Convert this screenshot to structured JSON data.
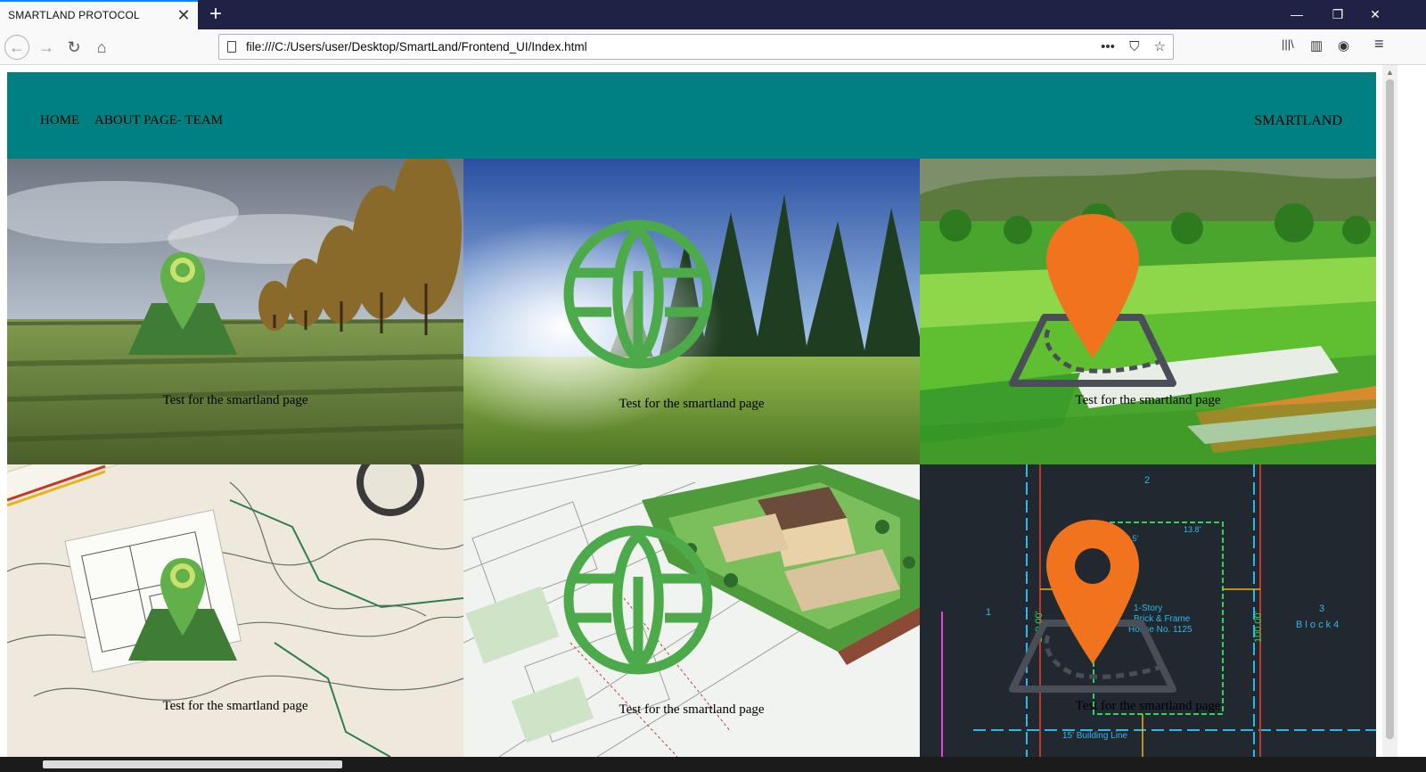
{
  "browser": {
    "tab_title": "SMARTLAND PROTOCOL",
    "tab_close": "✕",
    "new_tab": "+",
    "url": "file:///C:/Users/user/Desktop/SmartLand/Frontend_UI/Index.html",
    "window_controls": {
      "minimize": "—",
      "restore": "❐",
      "close": "✕"
    },
    "nav_icons": {
      "back": "←",
      "forward": "→",
      "reload": "↻",
      "home": "⌂"
    },
    "url_actions": {
      "more": "•••",
      "pocket": "⛉",
      "bookmark": "☆"
    },
    "toolbar_icons": {
      "library": "|||\\",
      "sidebar": "▥",
      "account": "◉",
      "menu": "≡"
    }
  },
  "site": {
    "nav_links": [
      "HOME",
      "ABOUT PAGE- TEAM"
    ],
    "brand": "SMARTLAND",
    "nav_color": "#008080"
  },
  "tiles": [
    {
      "caption": "Test for the smartland page",
      "icon": "map-pin-field-icon",
      "background": "farm-field-with-trees"
    },
    {
      "caption": "Test for the smartland page",
      "icon": "leaf-globe-icon",
      "background": "forest-meadow-sunrise"
    },
    {
      "caption": "Test for the smartland page",
      "icon": "orange-map-pin-area-icon",
      "background": "green-terraced-farmland"
    },
    {
      "caption": "Test for the smartland page",
      "icon": "map-pin-field-icon",
      "background": "survey-map-with-blueprint"
    },
    {
      "caption": "Test for the smartland page",
      "icon": "leaf-globe-icon",
      "background": "3d-site-plan-house"
    },
    {
      "caption": "Test for the smartland page",
      "icon": "orange-map-pin-area-icon",
      "background": "cad-plot-drawing-dark"
    }
  ],
  "cad_text": {
    "number_top": "2",
    "number_left": "1",
    "number_right": "3",
    "block": "B l o c k 4",
    "house": "1-Story",
    "house2": "Brick & Frame",
    "house3": "House No. 1125",
    "building_line": "15' Building Line",
    "dim1": "100.00'",
    "dim2": "100.00'",
    "dim3": "19.5'",
    "dim4": "13.8'"
  }
}
